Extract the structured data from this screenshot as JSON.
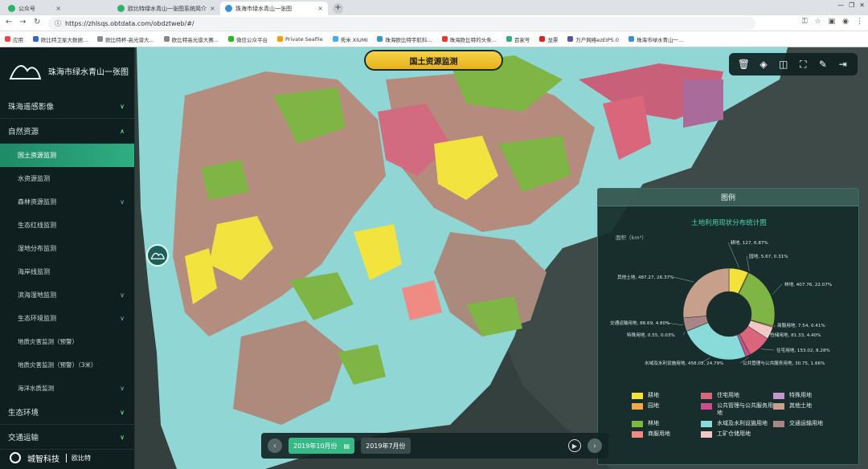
{
  "browser": {
    "tabs": [
      {
        "label": "公众号",
        "color": "#2db36b"
      },
      {
        "label": "欧比特绿水青山一张图系统简介",
        "color": "#2db36b"
      },
      {
        "label": "珠海市绿水青山一张图",
        "color": "#3b8fd8"
      }
    ],
    "url": "https://zhlsqs.obtdata.com/obdztweb/#/",
    "bookmarks": [
      "应用",
      "欧比特卫星大数据...",
      "欧比特杯-高光谱大...",
      "欧比特高光谱大赛...",
      "微信公众平台",
      "Private Seafile",
      "秀米 XIUMI",
      "珠海欧比特宇航科...",
      "珠海欧比特的头条...",
      "百家号",
      "龙票",
      "万户网络ezEIP5.0",
      "珠海市绿水青山一..."
    ]
  },
  "app": {
    "title": "珠海市绿水青山一张图",
    "module_title": "国土资源监测",
    "menu": [
      {
        "label": "珠海遥感影像",
        "type": "top",
        "chev": "∨"
      },
      {
        "label": "自然资源",
        "type": "top",
        "chev": "∧"
      },
      {
        "label": "国土资源监测",
        "type": "sub",
        "active": true
      },
      {
        "label": "水资源监测",
        "type": "sub"
      },
      {
        "label": "森林资源监测",
        "type": "sub",
        "chev": "∨"
      },
      {
        "label": "生态红线监测",
        "type": "sub"
      },
      {
        "label": "湿地分布监测",
        "type": "sub"
      },
      {
        "label": "海岸线监测",
        "type": "sub"
      },
      {
        "label": "滨海湿地监测",
        "type": "sub",
        "chev": "∨"
      },
      {
        "label": "生态环境监测",
        "type": "sub",
        "chev": "∨"
      },
      {
        "label": "地质灾害监测（预警）",
        "type": "sub"
      },
      {
        "label": "地质灾害监测（预警）（3米）",
        "type": "sub"
      },
      {
        "label": "海洋水质监测",
        "type": "sub",
        "chev": "∨"
      },
      {
        "label": "生态环境",
        "type": "top",
        "chev": "∨"
      },
      {
        "label": "交通运输",
        "type": "top",
        "chev": "∨"
      }
    ],
    "footer_brand": "城智科技",
    "footer_brand2": "欧比特"
  },
  "toolbar": {
    "icons": [
      "trash-icon",
      "layers-icon",
      "split-view-icon",
      "fullscreen-icon",
      "measure-icon",
      "exit-icon"
    ]
  },
  "legend": {
    "header": "图例",
    "chart_title": "土地利用现状分布统计图",
    "unit": "面积（km²）",
    "items": [
      {
        "label": "耕地",
        "color": "#f3e23a"
      },
      {
        "label": "住宅用地",
        "color": "#d9667a"
      },
      {
        "label": "特殊用地",
        "color": "#c596c9"
      },
      {
        "label": "园地",
        "color": "#f0a84a"
      },
      {
        "label": "公共管理与公共服务用地",
        "color": "#c8508b"
      },
      {
        "label": "其他土地",
        "color": "#c6a08a"
      },
      {
        "label": "林地",
        "color": "#7fb545"
      },
      {
        "label": "水域及水利设施用地",
        "color": "#88dbd9"
      },
      {
        "label": "交通运输用地",
        "color": "#a98585"
      },
      {
        "label": "商服用地",
        "color": "#f08b84"
      },
      {
        "label": "工矿仓储用地",
        "color": "#f2c8c4"
      }
    ]
  },
  "chart_data": {
    "type": "pie",
    "title": "土地利用现状分布统计图",
    "ylabel": "面积（km²）",
    "slices": [
      {
        "name": "耕地",
        "value": 127,
        "percent": 6.87,
        "label": "耕地, 127, 6.87%",
        "color": "#f3e23a"
      },
      {
        "name": "园地",
        "value": 5.67,
        "percent": 0.31,
        "label": "园地, 5.67, 0.31%",
        "color": "#f0a84a"
      },
      {
        "name": "林地",
        "value": 407.76,
        "percent": 22.07,
        "label": "林地, 407.76, 22.07%",
        "color": "#7fb545"
      },
      {
        "name": "商服用地",
        "value": 7.54,
        "percent": 0.41,
        "label": "商服用地, 7.54, 0.41%",
        "color": "#f08b84"
      },
      {
        "name": "工矿仓储用地",
        "value": 81.33,
        "percent": 4.4,
        "label": "工矿仓储用地, 81.33, 4.40%",
        "color": "#f2c8c4"
      },
      {
        "name": "住宅用地",
        "value": 153.02,
        "percent": 8.28,
        "label": "住宅用地, 153.02, 8.28%",
        "color": "#d9667a"
      },
      {
        "name": "公共管理与公共服务用地",
        "value": 30.75,
        "percent": 1.66,
        "label": "公共管理与公共服务用地, 30.75, 1.66%",
        "color": "#c8508b"
      },
      {
        "name": "水域及水利设施用地",
        "value": 458.03,
        "percent": 24.79,
        "label": "水域及水利设施用地, 458.03, 24.79%",
        "color": "#88dbd9"
      },
      {
        "name": "特殊用地",
        "value": 0.55,
        "percent": 0.03,
        "label": "特殊用地, 0.55, 0.03%",
        "color": "#c596c9"
      },
      {
        "name": "交通运输用地",
        "value": 88.69,
        "percent": 4.8,
        "label": "交通运输用地, 88.69, 4.80%",
        "color": "#a98585"
      },
      {
        "name": "其他土地",
        "value": 487.27,
        "percent": 26.37,
        "label": "其他土地, 487.27, 26.37%",
        "color": "#c6a08a"
      }
    ]
  },
  "timebar": {
    "selected": "2019年10月份",
    "other": "2019年7月份"
  }
}
